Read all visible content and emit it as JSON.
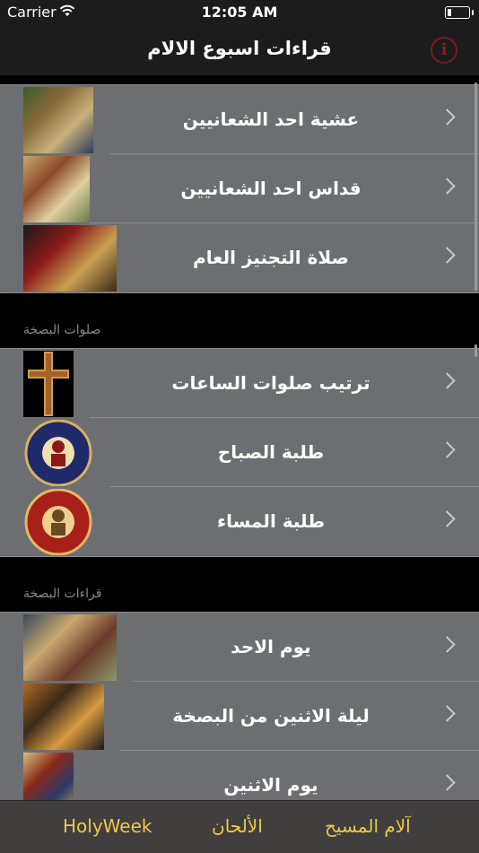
{
  "status_bar": {
    "carrier": "Carrier",
    "time": "12:05 AM"
  },
  "nav": {
    "title": "قراءات اسبوع الالام"
  },
  "sections": [
    {
      "header": "",
      "rows": [
        {
          "label": "عشية احد الشعانيين",
          "thumb_colors": [
            "#3d5a2a",
            "#8a6b3a",
            "#c9b07a",
            "#2b3d5e"
          ]
        },
        {
          "label": "قداس احد الشعانيين",
          "thumb_colors": [
            "#c9a86a",
            "#8c4a2a",
            "#e0cfa0",
            "#6a7a4a"
          ]
        },
        {
          "label": "صلاة التجنيز العام",
          "thumb_colors": [
            "#1a1a1a",
            "#8a1a1a",
            "#c8a050",
            "#3a2a1a"
          ]
        }
      ]
    },
    {
      "header": "صلوات البصخة",
      "rows": [
        {
          "label": "ترتيب صلوات الساعات",
          "thumb_colors": [
            "#000000",
            "#a0642a",
            "#d49a50",
            "#5a3010"
          ]
        },
        {
          "label": "طلبة الصباح",
          "thumb_colors": [
            "#1f2a6a",
            "#d8b060",
            "#8a1a1a",
            "#f0e0b0"
          ]
        },
        {
          "label": "طلبة المساء",
          "thumb_colors": [
            "#a8201a",
            "#e8b860",
            "#6a4a20",
            "#f0d090"
          ]
        }
      ]
    },
    {
      "header": "قراءات البصخة",
      "rows": [
        {
          "label": "يوم الاحد",
          "thumb_colors": [
            "#3a4a5a",
            "#c8a870",
            "#6a3a2a",
            "#8a9a6a"
          ]
        },
        {
          "label": "ليلة الاثنين من البصخة",
          "thumb_colors": [
            "#b06a20",
            "#3a2a1a",
            "#d89a40",
            "#1a1a1a"
          ]
        },
        {
          "label": "يوم الاثنين",
          "thumb_colors": [
            "#d8c080",
            "#8a2a1a",
            "#2a3a6a",
            "#c8a050"
          ]
        }
      ]
    }
  ],
  "tabs": [
    {
      "label": "آلام المسيح"
    },
    {
      "label": "الألحان"
    },
    {
      "label": "HolyWeek"
    }
  ],
  "colors": {
    "row_bg": "#6d6e72",
    "tab_text": "#f0c84a",
    "info_icon": "#8c1d1d"
  }
}
